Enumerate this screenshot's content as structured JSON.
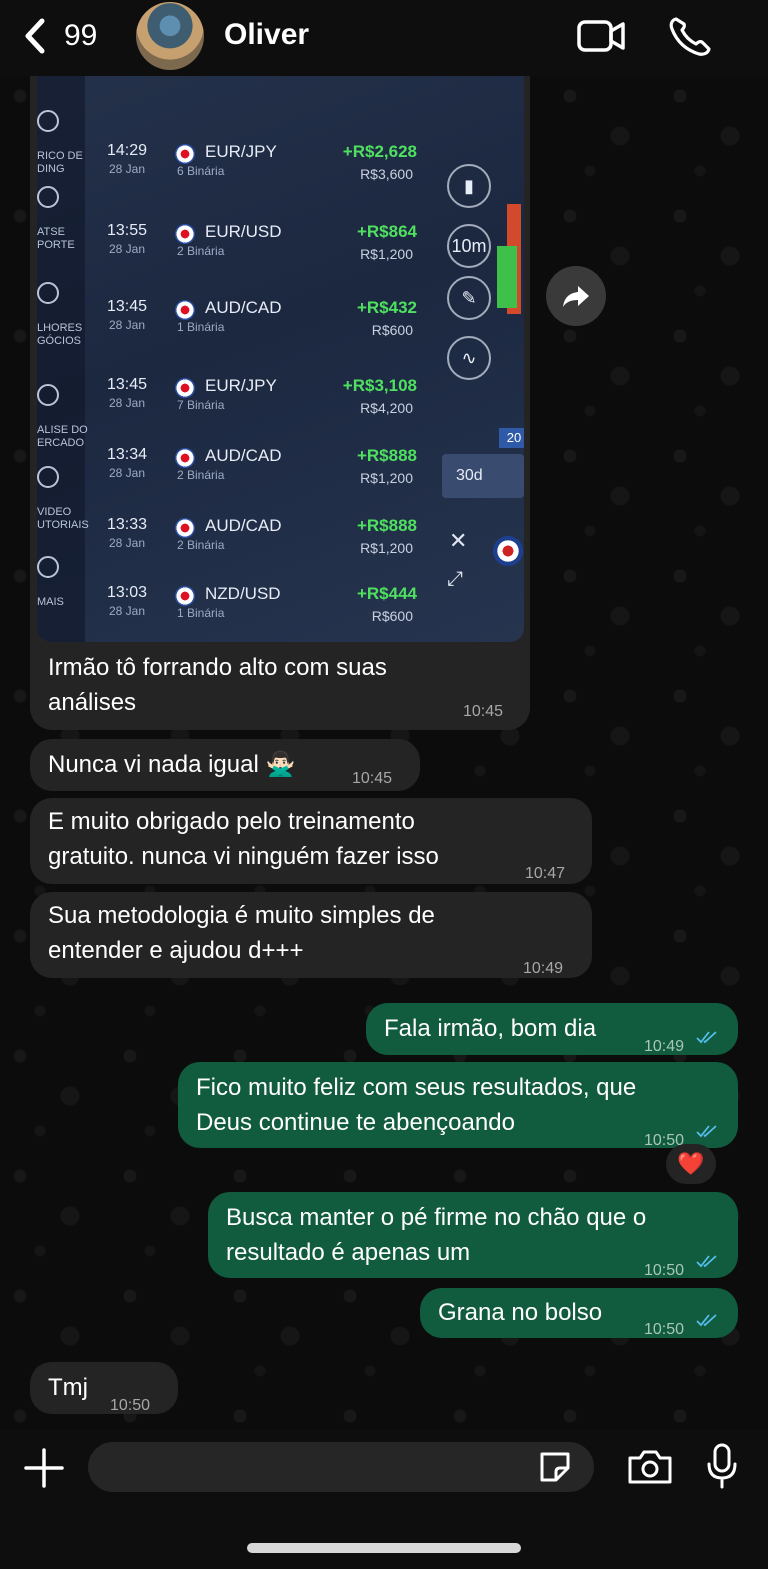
{
  "header": {
    "back_count": "99",
    "contact_name": "Oliver"
  },
  "trade_image": {
    "sidebar": [
      {
        "label": "RICO DE\nDING"
      },
      {
        "label": "ATSE\nPORTE"
      },
      {
        "label": "LHORES\nGÓCIOS"
      },
      {
        "label": "ALISE DO\nERCADO"
      },
      {
        "label": "VIDEO\nUTORIAIS"
      },
      {
        "label": "MAIS"
      }
    ],
    "rows": [
      {
        "time": "14:29",
        "date": "28 Jan",
        "pair": "EUR/JPY",
        "binary": "6 Binária",
        "profit": "+R$2,628",
        "amount": "R$3,600"
      },
      {
        "time": "13:55",
        "date": "28 Jan",
        "pair": "EUR/USD",
        "binary": "2 Binária",
        "profit": "+R$864",
        "amount": "R$1,200"
      },
      {
        "time": "13:45",
        "date": "28 Jan",
        "pair": "AUD/CAD",
        "binary": "1 Binária",
        "profit": "+R$432",
        "amount": "R$600"
      },
      {
        "time": "13:45",
        "date": "28 Jan",
        "pair": "EUR/JPY",
        "binary": "7 Binária",
        "profit": "+R$3,108",
        "amount": "R$4,200"
      },
      {
        "time": "13:34",
        "date": "28 Jan",
        "pair": "AUD/CAD",
        "binary": "2 Binária",
        "profit": "+R$888",
        "amount": "R$1,200"
      },
      {
        "time": "13:33",
        "date": "28 Jan",
        "pair": "AUD/CAD",
        "binary": "2 Binária",
        "profit": "+R$888",
        "amount": "R$1,200"
      },
      {
        "time": "13:03",
        "date": "28 Jan",
        "pair": "NZD/USD",
        "binary": "1 Binária",
        "profit": "+R$444",
        "amount": "R$600"
      }
    ],
    "tools": {
      "timeframe": "10m",
      "period": "30d",
      "badge": "20"
    }
  },
  "messages": [
    {
      "dir": "in",
      "lines": [
        "Irmão tô forrando alto com suas",
        "análises"
      ],
      "time": "10:45"
    },
    {
      "dir": "in",
      "lines": [
        "Nunca vi nada igual 🙅🏻‍♂️"
      ],
      "time": "10:45"
    },
    {
      "dir": "in",
      "lines": [
        "E muito obrigado pelo treinamento",
        "gratuito. nunca vi ninguém fazer isso"
      ],
      "time": "10:47"
    },
    {
      "dir": "in",
      "lines": [
        "Sua metodologia é muito simples de",
        "entender e ajudou d+++"
      ],
      "time": "10:49"
    },
    {
      "dir": "out",
      "lines": [
        "Fala irmão, bom dia"
      ],
      "time": "10:49"
    },
    {
      "dir": "out",
      "lines": [
        "Fico muito feliz com seus resultados, que",
        "Deus continue te abençoando"
      ],
      "time": "10:50"
    },
    {
      "dir": "out",
      "lines": [
        "Busca manter o pé firme no chão que o",
        "resultado é apenas um"
      ],
      "time": "10:50"
    },
    {
      "dir": "out",
      "lines": [
        "Grana no bolso"
      ],
      "time": "10:50"
    },
    {
      "dir": "in",
      "lines": [
        "Tmj"
      ],
      "time": "10:50"
    }
  ],
  "reaction": "❤️",
  "colors": {
    "outgoing": "#115b3e",
    "incoming": "#242424",
    "profit": "#4fe060"
  }
}
